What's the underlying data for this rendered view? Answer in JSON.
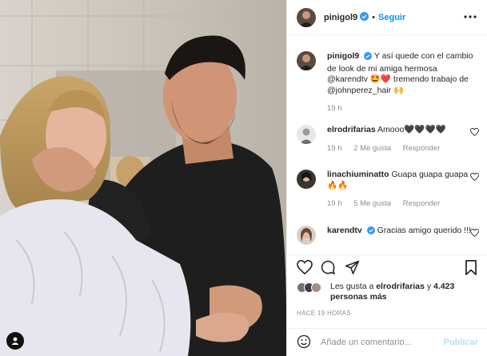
{
  "post": {
    "photo_alt": "",
    "user_tag_icon": "person-icon"
  },
  "header": {
    "username": "pinigol9",
    "separator": "•",
    "follow_label": "Seguir",
    "more_icon": "more-horizontal-icon"
  },
  "caption": {
    "username": "pinigol9",
    "text": "Y así quede con el cambio de look de mi amiga hermosa @karendtv 🤩❤️ tremendo trabajo de @johnperez_hair 🙌",
    "time": "19 h"
  },
  "comments": [
    {
      "username": "elrodrifarias",
      "text": "Amooo🖤🖤🖤🖤",
      "time": "19 h",
      "likes": "2 Me gusta",
      "reply": "Responder"
    },
    {
      "username": "linachiuminatto",
      "text": "Guapa guapa guapa 🔥🔥",
      "time": "19 h",
      "likes": "5 Me gusta",
      "reply": "Responder"
    },
    {
      "username": "karendtv",
      "text": "Gracias amigo querido !!!",
      "time": "",
      "likes": "",
      "reply": ""
    }
  ],
  "actions": {
    "like_icon": "heart-icon",
    "comment_icon": "comment-icon",
    "share_icon": "share-icon",
    "save_icon": "bookmark-icon"
  },
  "likes": {
    "prefix": "Les gusta a ",
    "user": "elrodrifarias",
    "middle": " y ",
    "count": "4.423 personas más"
  },
  "timestamp": "HACE 19 HORAS",
  "composer": {
    "emoji_icon": "emoji-icon",
    "placeholder": "Añade un comentario...",
    "publish_label": "Publicar"
  },
  "colors": {
    "accent": "#0095f6",
    "verified": "#3897f0",
    "muted": "#8e8e8e",
    "publish_disabled": "#b2dffc"
  }
}
